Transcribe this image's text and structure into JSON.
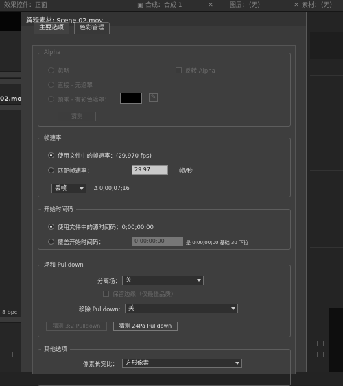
{
  "background": {
    "tabs": [
      {
        "label": "效果控件：正面"
      },
      {
        "label": "合成：合成 1"
      },
      {
        "label": "图层：（无）"
      },
      {
        "label": "素材：（无）"
      }
    ],
    "close_glyph": "✕",
    "project_filename": "02.mov",
    "bit_depth": "8 bpc"
  },
  "dialog": {
    "title": "解释素材: Scene 02.mov",
    "tabs": [
      {
        "label": "主要选项",
        "active": true
      },
      {
        "label": "色彩管理",
        "active": false
      }
    ],
    "alpha": {
      "legend": "Alpha",
      "ignore": "忽略",
      "invert": "反转 Alpha",
      "straight": "直接 - 无遮罩",
      "premultiplied": "预乘 - 有彩色遮罩：",
      "matte_color": "#000000",
      "guess": "猜测"
    },
    "frame_rate": {
      "legend": "帧速率",
      "use_file": "使用文件中的帧速率：(29.970 fps)",
      "conform": "匹配帧速率：",
      "conform_value": "29.97",
      "conform_unit": "帧/秒",
      "drop_frame": "丢帧",
      "duration": "Δ 0;00;07;16"
    },
    "timecode": {
      "legend": "开始时间码",
      "use_source": "使用文件中的源时间码：0;00;00;00",
      "override": "覆盖开始时间码：",
      "override_value": "0;00;00;00",
      "override_note": "是 0;00;00;00  基础 30 下拉"
    },
    "fields": {
      "legend": "场和 Pulldown",
      "separate_label": "分离场：",
      "separate_value": "关",
      "preserve_edges": "保留边缘（仅最佳品质）",
      "remove_label": "移除 Pulldown:",
      "remove_value": "关",
      "guess_32": "猜测 3:2 Pulldown",
      "guess_24pa": "猜测 24Pa Pulldown"
    },
    "other": {
      "legend": "其他选项",
      "par_label": "像素长宽比：",
      "par_value": "方形像素"
    }
  }
}
